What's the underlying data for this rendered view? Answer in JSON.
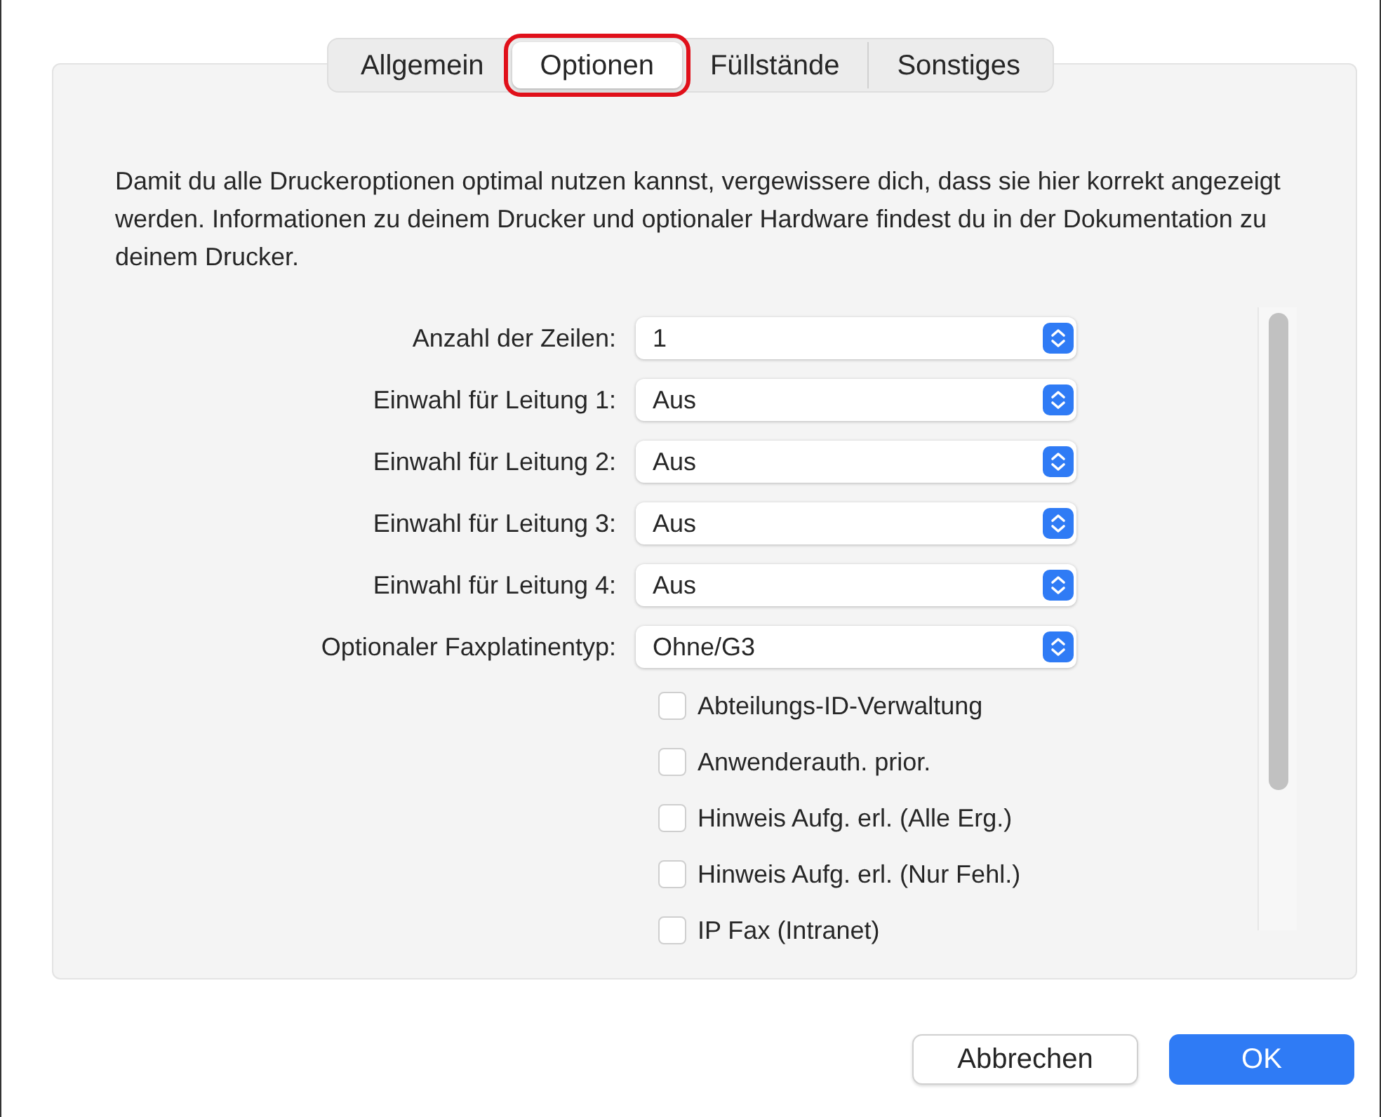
{
  "tabs": [
    {
      "label": "Allgemein",
      "selected": false
    },
    {
      "label": "Optionen",
      "selected": true
    },
    {
      "label": "Füllstände",
      "selected": false
    },
    {
      "label": "Sonstiges",
      "selected": false
    }
  ],
  "description": "Damit du alle Druckeroptionen optimal nutzen kannst, vergewissere dich, dass sie hier korrekt angezeigt werden. Informationen zu deinem Drucker und optionaler Hardware findest du in der Dokumentation zu deinem Drucker.",
  "options": [
    {
      "kind": "select",
      "label": "Anzahl der Zeilen:",
      "value": "1"
    },
    {
      "kind": "select",
      "label": "Einwahl für Leitung 1:",
      "value": "Aus"
    },
    {
      "kind": "select",
      "label": "Einwahl für Leitung 2:",
      "value": "Aus"
    },
    {
      "kind": "select",
      "label": "Einwahl für Leitung 3:",
      "value": "Aus"
    },
    {
      "kind": "select",
      "label": "Einwahl für Leitung 4:",
      "value": "Aus"
    },
    {
      "kind": "select",
      "label": "Optionaler Faxplatinentyp:",
      "value": "Ohne/G3"
    },
    {
      "kind": "checkbox",
      "label": "Abteilungs-ID-Verwaltung",
      "checked": false
    },
    {
      "kind": "checkbox",
      "label": "Anwenderauth. prior.",
      "checked": false
    },
    {
      "kind": "checkbox",
      "label": "Hinweis Aufg. erl. (Alle Erg.)",
      "checked": false
    },
    {
      "kind": "checkbox",
      "label": "Hinweis Aufg. erl. (Nur Fehl.)",
      "checked": false
    },
    {
      "kind": "checkbox",
      "label": "IP Fax (Intranet)",
      "checked": false
    }
  ],
  "buttons": [
    {
      "label": "Abbrechen",
      "kind": "secondary"
    },
    {
      "label": "OK",
      "kind": "primary"
    }
  ]
}
